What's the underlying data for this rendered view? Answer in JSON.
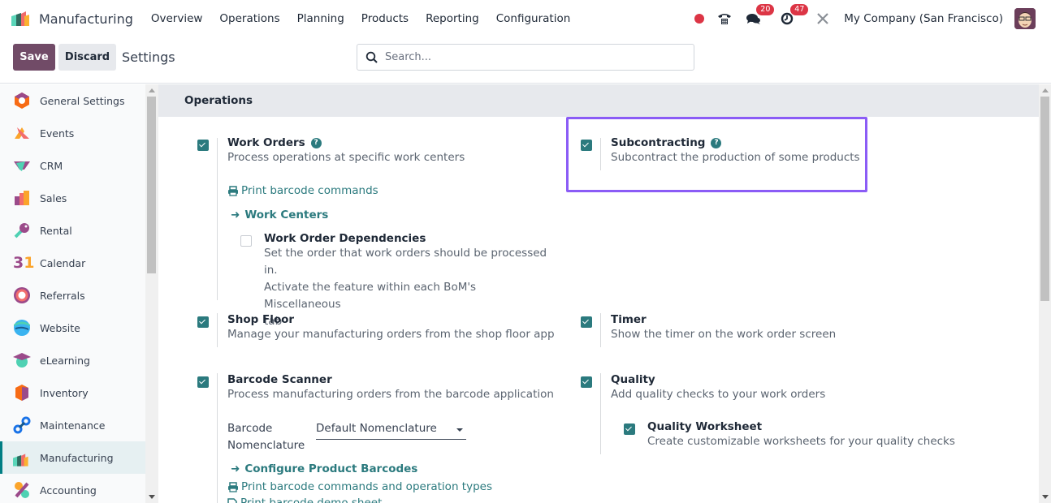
{
  "navbar": {
    "app_name": "Manufacturing",
    "menu": [
      "Overview",
      "Operations",
      "Planning",
      "Products",
      "Reporting",
      "Configuration"
    ],
    "messages_count": "20",
    "activities_count": "47",
    "company": "My Company (San Francisco)"
  },
  "control": {
    "save_label": "Save",
    "discard_label": "Discard",
    "title": "Settings",
    "search_placeholder": "Search..."
  },
  "sidebar": {
    "items": [
      {
        "label": "General Settings",
        "icon": "general-settings-icon"
      },
      {
        "label": "Events",
        "icon": "events-icon"
      },
      {
        "label": "CRM",
        "icon": "crm-icon"
      },
      {
        "label": "Sales",
        "icon": "sales-icon"
      },
      {
        "label": "Rental",
        "icon": "rental-icon"
      },
      {
        "label": "Calendar",
        "icon": "calendar-icon"
      },
      {
        "label": "Referrals",
        "icon": "referrals-icon"
      },
      {
        "label": "Website",
        "icon": "website-icon"
      },
      {
        "label": "eLearning",
        "icon": "elearning-icon"
      },
      {
        "label": "Inventory",
        "icon": "inventory-icon"
      },
      {
        "label": "Maintenance",
        "icon": "maintenance-icon"
      },
      {
        "label": "Manufacturing",
        "icon": "manufacturing-icon",
        "active": true
      },
      {
        "label": "Accounting",
        "icon": "accounting-icon"
      }
    ],
    "calendar_glyph": "31"
  },
  "section": {
    "title": "Operations",
    "settings": {
      "work_orders": {
        "title": "Work Orders",
        "desc": "Process operations at specific work centers",
        "checked": true,
        "print_link": "Print barcode commands",
        "work_centers_link": "Work Centers",
        "dependencies": {
          "title": "Work Order Dependencies",
          "desc": "Set the order that work orders should be processed in. Activate the feature within each BoM's Miscellaneous tab",
          "desc_lines": [
            "Set the order that work orders should be processed in.",
            "Activate the feature within each BoM's Miscellaneous",
            "tab"
          ],
          "checked": false
        }
      },
      "subcontracting": {
        "title": "Subcontracting",
        "desc": "Subcontract the production of some products",
        "checked": true
      },
      "shop_floor": {
        "title": "Shop Floor",
        "desc": "Manage your manufacturing orders from the shop floor app",
        "checked": true
      },
      "timer": {
        "title": "Timer",
        "desc": "Show the timer on the work order screen",
        "checked": true
      },
      "barcode_scanner": {
        "title": "Barcode Scanner",
        "desc": "Process manufacturing orders from the barcode application",
        "checked": true,
        "nomenclature_label_1": "Barcode",
        "nomenclature_label_2": "Nomenclature",
        "nomenclature_value": "Default Nomenclature",
        "configure_link": "Configure Product Barcodes",
        "print_link": "Print barcode commands and operation types",
        "demo_link": "Print barcode demo sheet"
      },
      "quality": {
        "title": "Quality",
        "desc": "Add quality checks to your work orders",
        "checked": true,
        "worksheet": {
          "title": "Quality Worksheet",
          "desc": "Create customizable worksheets for your quality checks",
          "checked": true
        }
      }
    }
  },
  "colors": {
    "brand": "#714b67",
    "accent": "#2b7a7e",
    "highlight": "#8b5cf6",
    "badge": "#dc3545"
  }
}
